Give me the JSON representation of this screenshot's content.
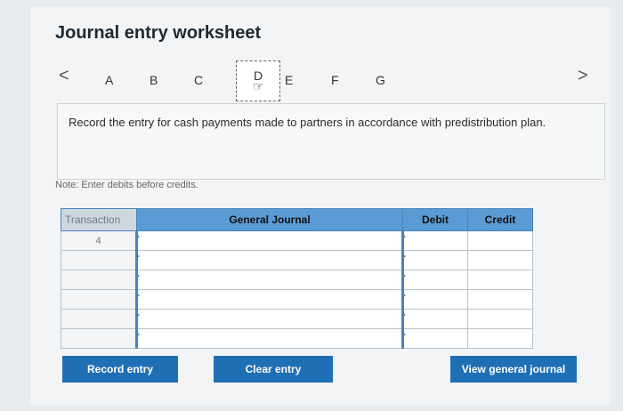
{
  "header": {
    "title": "Journal entry worksheet"
  },
  "tabs": {
    "prev": "<",
    "next": ">",
    "items": [
      "A",
      "B",
      "C",
      "D",
      "E",
      "F",
      "G"
    ],
    "active": "D"
  },
  "instruction": "Record the entry for cash payments made to partners in accordance with predistribution plan.",
  "note": "Note: Enter debits before credits.",
  "table": {
    "headers": {
      "transaction": "Transaction",
      "journal": "General Journal",
      "debit": "Debit",
      "credit": "Credit"
    },
    "rows": [
      {
        "transaction": "4",
        "journal": "",
        "debit": "",
        "credit": ""
      },
      {
        "transaction": "",
        "journal": "",
        "debit": "",
        "credit": ""
      },
      {
        "transaction": "",
        "journal": "",
        "debit": "",
        "credit": ""
      },
      {
        "transaction": "",
        "journal": "",
        "debit": "",
        "credit": ""
      },
      {
        "transaction": "",
        "journal": "",
        "debit": "",
        "credit": ""
      },
      {
        "transaction": "",
        "journal": "",
        "debit": "",
        "credit": ""
      }
    ]
  },
  "buttons": {
    "record": "Record entry",
    "clear": "Clear entry",
    "view": "View general journal"
  },
  "colors": {
    "accent": "#1f6fb5",
    "header_blue": "#5b9bd5"
  }
}
